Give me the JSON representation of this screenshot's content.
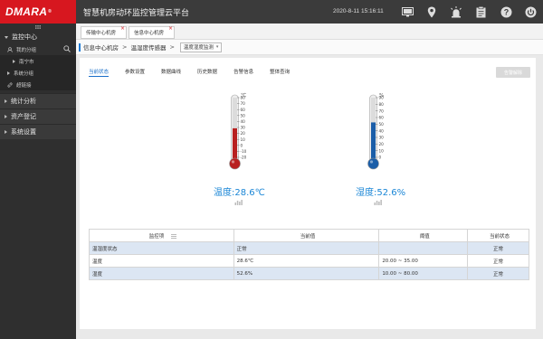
{
  "header": {
    "logo_text": "DMARA",
    "logo_mark": "®",
    "title": "智慧机房动环监控管理云平台",
    "datetime": "2020-8-11 15:16:11",
    "icons": [
      "monitor-icon",
      "location-pin-icon",
      "alarm-siren-icon",
      "clipboard-icon",
      "help-icon",
      "power-icon"
    ]
  },
  "sidebar": {
    "section": "监控中心",
    "groups": [
      {
        "label": "我的分组",
        "children": [
          "南宁市"
        ]
      },
      {
        "label": "系统分组"
      },
      {
        "label": "超链接"
      }
    ],
    "main_items": [
      "统计分析",
      "资产登记",
      "系统设置"
    ]
  },
  "page_tabs": [
    {
      "label": "传输中心机房"
    },
    {
      "label": "信息中心机房"
    }
  ],
  "breadcrumb": {
    "items": [
      "信息中心机房",
      "温湿度传感器"
    ],
    "select_value": "温度湿度监测"
  },
  "subtabs": [
    "当前状态",
    "参数设置",
    "数据曲线",
    "历史数据",
    "告警信息",
    "整体查询"
  ],
  "relieve_button": "告警解除",
  "gauges": {
    "temperature": {
      "unit": "℃",
      "ticks": [
        "80",
        "70",
        "60",
        "50",
        "40",
        "30",
        "20",
        "10",
        "0",
        "-10",
        "-20"
      ],
      "value": 28.6,
      "min": -20,
      "max": 80,
      "label": "温度:28.6℃",
      "color": "#b82020"
    },
    "humidity": {
      "unit": "%",
      "ticks": [
        "90",
        "80",
        "70",
        "60",
        "50",
        "40",
        "30",
        "20",
        "10",
        "0"
      ],
      "value": 52.6,
      "min": 0,
      "max": 90,
      "label": "湿度:52.6%",
      "color": "#1b5ea8"
    }
  },
  "table": {
    "headers": [
      "监控项",
      "当前值",
      "阈值",
      "当前状态"
    ],
    "rows": [
      {
        "item": "温湿度状态",
        "value": "正常",
        "threshold": "",
        "status": "正常"
      },
      {
        "item": "温度",
        "value": "28.6℃",
        "threshold": "20.00 ~ 35.00",
        "status": "正常"
      },
      {
        "item": "湿度",
        "value": "52.6%",
        "threshold": "10.00 ~ 80.00",
        "status": "正常"
      }
    ]
  }
}
